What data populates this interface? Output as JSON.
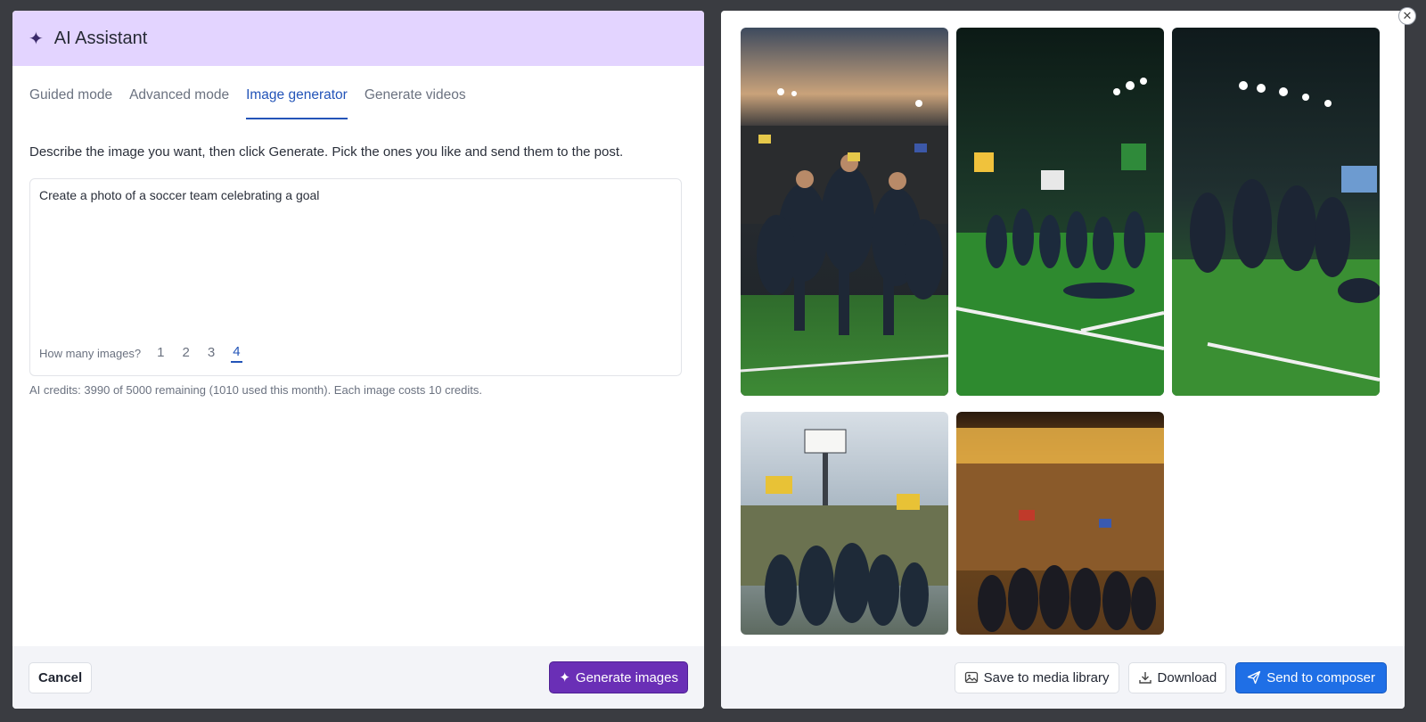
{
  "assistant": {
    "title": "AI Assistant",
    "icon": "sparkle-icon",
    "tabs": [
      {
        "label": "Guided mode",
        "active": false
      },
      {
        "label": "Advanced mode",
        "active": false
      },
      {
        "label": "Image generator",
        "active": true
      },
      {
        "label": "Generate videos",
        "active": false
      }
    ],
    "description": "Describe the image you want, then click Generate. Pick the ones you like and send them to the post.",
    "prompt_value": "Create a photo of a soccer team celebrating a goal",
    "count_label": "How many images?",
    "count_options": [
      "1",
      "2",
      "3",
      "4"
    ],
    "count_selected": "4",
    "credits_text": "AI credits: 3990 of 5000 remaining (1010 used this month). Each image costs 10 credits.",
    "cancel_label": "Cancel",
    "generate_label": "Generate images"
  },
  "gallery": {
    "images": [
      {
        "label": "generated-image-1",
        "subject": "players huddled celebrating at dusk"
      },
      {
        "label": "generated-image-2",
        "subject": "team running with flags under floodlights"
      },
      {
        "label": "generated-image-3",
        "subject": "players sliding in celebration"
      },
      {
        "label": "generated-image-4",
        "subject": "players celebrating with floodlight tower"
      },
      {
        "label": "generated-image-5",
        "subject": "players in front of crowd at night"
      }
    ],
    "save_label": "Save to media library",
    "download_label": "Download",
    "send_label": "Send to composer"
  },
  "colors": {
    "header_bg": "#e3d4ff",
    "accent": "#2354b8",
    "generate_bg": "#6a2fb6",
    "primary": "#1f6fe6"
  }
}
